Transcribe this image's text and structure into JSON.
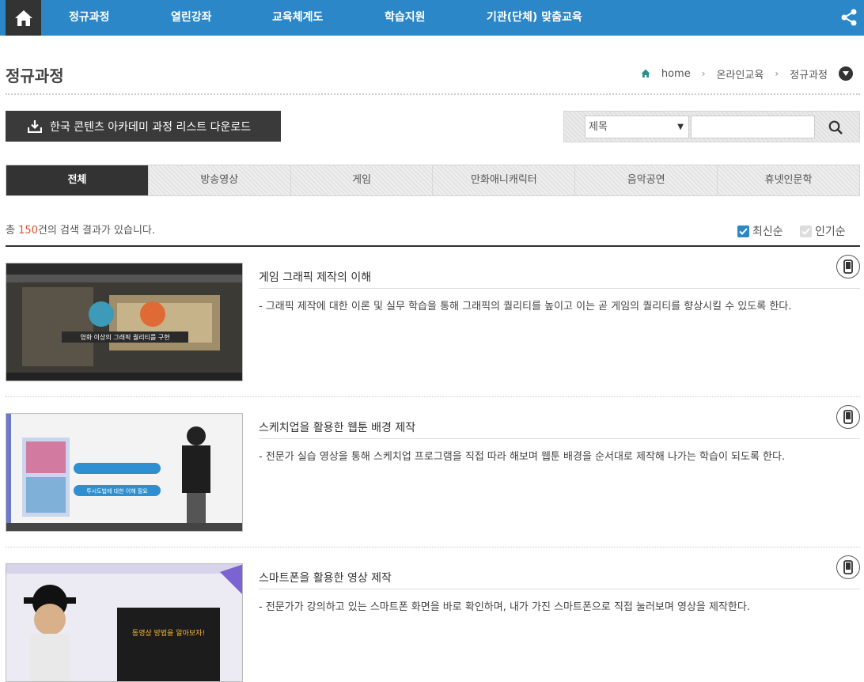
{
  "nav": {
    "items": [
      "정규과정",
      "열린강좌",
      "교육체계도",
      "학습지원",
      "기관(단체) 맞춤교육"
    ]
  },
  "page": {
    "title": "정규과정",
    "breadcrumb": [
      "home",
      "온라인교육",
      "정규과정"
    ]
  },
  "download": {
    "label": "한국 콘텐츠 아카데미 과정 리스트 다운로드"
  },
  "search": {
    "select_value": "제목",
    "placeholder": ""
  },
  "tabs": [
    "전체",
    "방송영상",
    "게임",
    "만화애니캐릭터",
    "음악공연",
    "휴넷인문학"
  ],
  "results": {
    "prefix": "총 ",
    "count": "150",
    "suffix": "건의 검색 결과가 있습니다."
  },
  "sort": {
    "latest": "최신순",
    "popular": "인기순"
  },
  "courses": [
    {
      "title": "게임 그래픽 제작의 이해",
      "desc": "- 그래픽 제작에 대한 이론 및 실무 학습을 통해 그래픽의 퀄리티를 높이고 이는 곧 게임의 퀄리티를 향상시킬 수 있도록 한다.",
      "thumb_text": "영화 이상의 그래픽 퀄리티를 구현"
    },
    {
      "title": "스케치업을 활용한 웹툰 배경 제작",
      "desc": "- 전문가 실습 영상을 통해 스케치업 프로그램을 직접 따라 해보며 웹툰 배경을 순서대로 제작해 나가는 학습이 되도록 한다.",
      "thumb_text": "투시도법에 대한 이해 필요"
    },
    {
      "title": "스마트폰을 활용한 영상 제작",
      "desc": "- 전문가가 강의하고 있는 스마트폰 화면을 바로 확인하며, 내가 가진 스마트폰으로 직접 눌러보며 영상을 제작한다.",
      "thumb_text": "동영상 방법을 알아보자!"
    }
  ],
  "colors": {
    "nav_bg": "#2b87c8",
    "dark": "#333333",
    "accent_count": "#e0502d"
  }
}
